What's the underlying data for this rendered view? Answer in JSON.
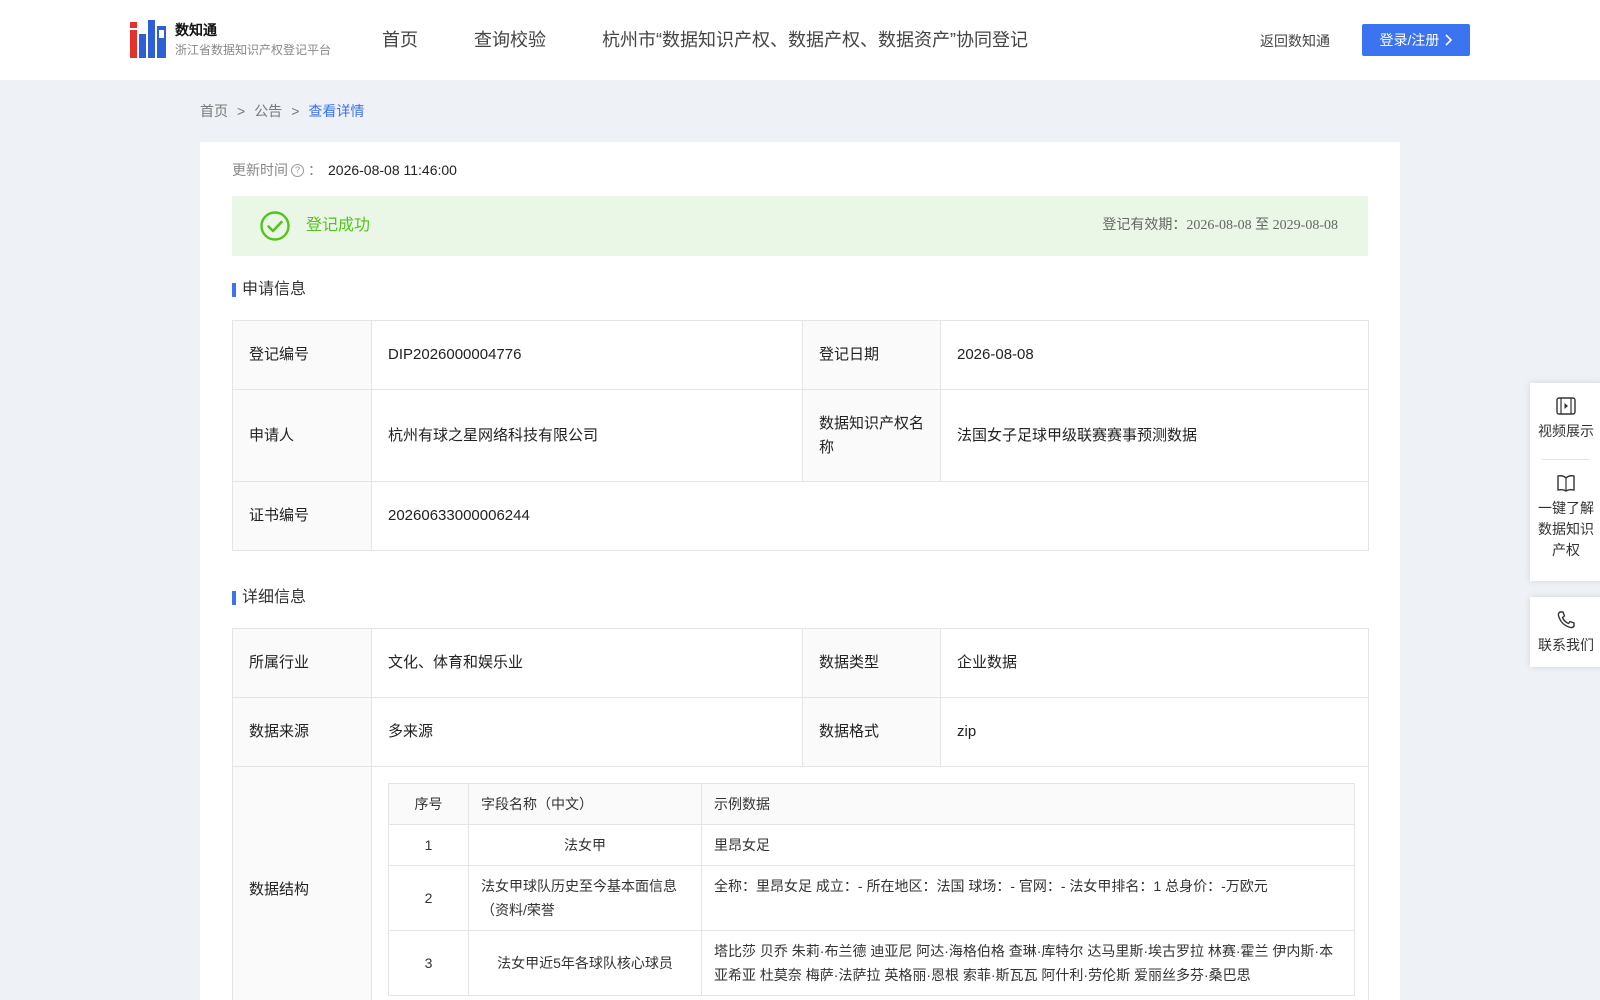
{
  "header": {
    "brand_name": "数知通",
    "brand_sub": "浙江省数据知识产权登记平台",
    "nav": [
      "首页",
      "查询校验",
      "杭州市“数据知识产权、数据产权、数据资产”协同登记"
    ],
    "back_link": "返回数知通",
    "login_label": "登录/注册"
  },
  "breadcrumb": [
    "首页",
    ">",
    "公告",
    ">",
    "查看详情"
  ],
  "update": {
    "label": "更新时间",
    "sep": "：",
    "value": "2026-08-08 11:46:00"
  },
  "status": {
    "text": "登记成功",
    "validity": "登记有效期：2026-08-08 至 2029-08-08",
    "color": "#52c41a"
  },
  "apply": {
    "title": "申请信息",
    "reg_no_label": "登记编号",
    "reg_no": "DIP2026000004776",
    "reg_date_label": "登记日期",
    "reg_date": "2026-08-08",
    "applicant_label": "申请人",
    "applicant": "杭州有球之星网络科技有限公司",
    "ip_name_label": "数据知识产权名称",
    "ip_name": "法国女子足球甲级联赛赛事预测数据",
    "cert_label": "证书编号",
    "cert": "20260633000006244"
  },
  "detail": {
    "title": "详细信息",
    "industry_label": "所属行业",
    "industry": "文化、体育和娱乐业",
    "type_label": "数据类型",
    "type": "企业数据",
    "source_label": "数据来源",
    "source": "多来源",
    "format_label": "数据格式",
    "format": "zip",
    "structure_label": "数据结构",
    "structure_headers": [
      "序号",
      "字段名称（中文）",
      "示例数据"
    ],
    "structure_rows": [
      [
        "1",
        "法女甲",
        "里昂女足"
      ],
      [
        "2",
        "法女甲球队历史至今基本面信息（资料/荣誉",
        "全称：里昂女足 成立：- 所在地区：法国 球场：- 官网：- 法女甲排名：1 总身价：-万欧元"
      ],
      [
        "3",
        "法女甲近5年各球队核心球员",
        "塔比莎 贝乔 朱莉·布兰德 迪亚尼 阿达·海格伯格 查琳·库特尔 达马里斯·埃古罗拉 林赛·霍兰 伊内斯·本亚希亚 杜莫奈 梅萨·法萨拉 英格丽·恩根 索菲·斯瓦瓦 阿什利·劳伦斯 爱丽丝多芬·桑巴思"
      ]
    ]
  },
  "float_panel": {
    "video": "视频展示",
    "learn": "一键了解数据知识产权",
    "contact": "联系我们"
  },
  "colors": {
    "accent": "#3b73f0",
    "success_bg": "#eaf7e6"
  }
}
